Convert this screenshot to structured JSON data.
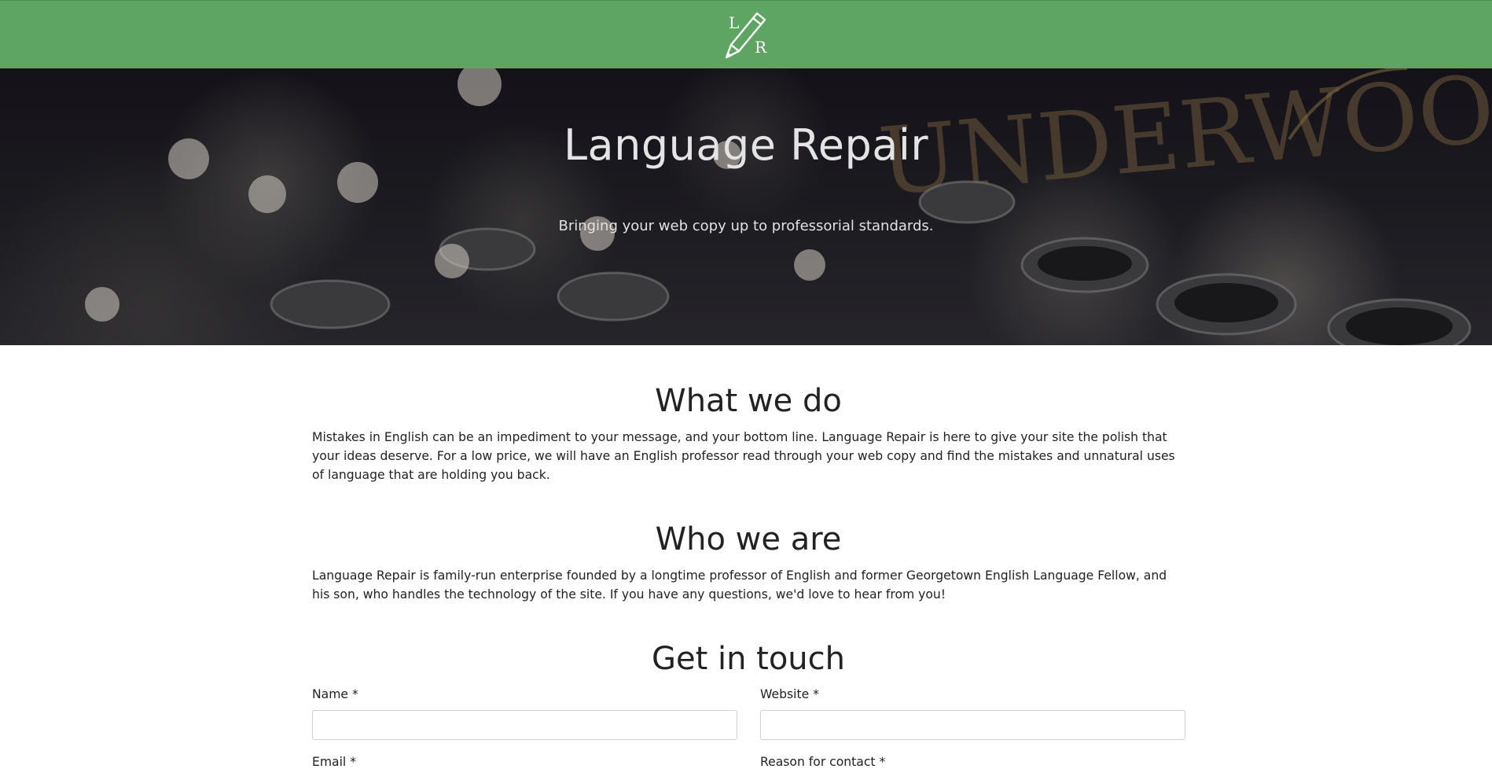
{
  "header": {
    "logo_letter_top": "L",
    "logo_letter_bottom": "R",
    "background_color": "#5ea563"
  },
  "hero": {
    "title": "Language Repair",
    "subtitle": "Bringing your web copy up to professorial standards.",
    "background_watermark": "UNDERWOOD"
  },
  "what_we_do": {
    "title": "What we do",
    "text": "Mistakes in English can be an impediment to your message, and your bottom line. Language Repair is here to give your site the polish that your ideas deserve. For a low price, we will have an English professor read through your web copy and find the mistakes and unnatural uses of language that are holding you back."
  },
  "who_we_are": {
    "title": "Who we are",
    "text": "Language Repair is family-run enterprise founded by a longtime professor of English and former Georgetown English Language Fellow, and his son, who handles the technology of the site. If you have any questions, we'd love to hear from you!"
  },
  "contact": {
    "title": "Get in touch",
    "name_label": "Name *",
    "name_value": "",
    "website_label": "Website *",
    "website_value": "",
    "email_label": "Email *",
    "reason_label": "Reason for contact *"
  }
}
